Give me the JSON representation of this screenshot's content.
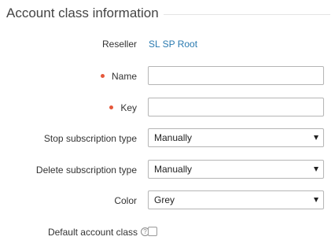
{
  "section": {
    "title": "Account class information"
  },
  "fields": {
    "reseller": {
      "label": "Reseller",
      "value": "SL SP Root"
    },
    "name": {
      "label": "Name",
      "value": "",
      "required": true
    },
    "key": {
      "label": "Key",
      "value": "",
      "required": true
    },
    "stop_subscription_type": {
      "label": "Stop subscription type",
      "selected": "Manually"
    },
    "delete_subscription_type": {
      "label": "Delete subscription type",
      "selected": "Manually"
    },
    "color": {
      "label": "Color",
      "selected": "Grey"
    },
    "default_account_class": {
      "label": "Default account class",
      "help_glyph": "?",
      "checked": false
    }
  },
  "colors": {
    "required_marker": "#e5583b",
    "link": "#2a7ab0"
  }
}
